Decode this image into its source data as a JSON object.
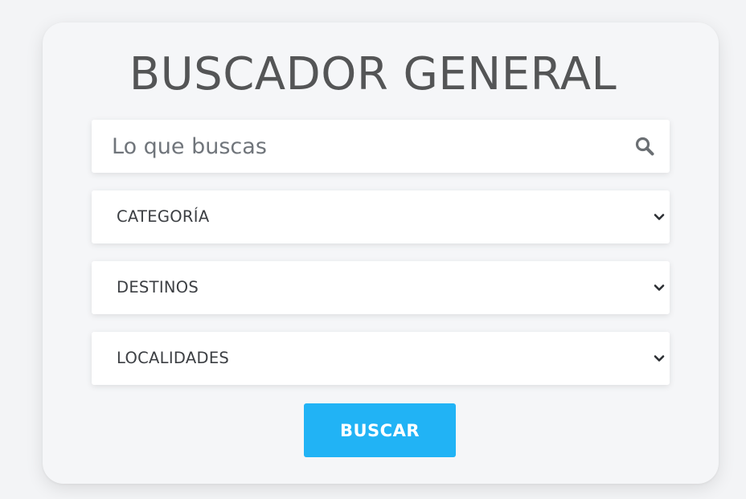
{
  "title": "BUSCADOR GENERAL",
  "search": {
    "placeholder": "Lo que buscas",
    "value": "",
    "icon": "search-icon"
  },
  "selects": {
    "category": {
      "selected": "CATEGORÍA",
      "icon": "chevron-down-icon"
    },
    "destinations": {
      "selected": "DESTINOS",
      "icon": "chevron-down-icon"
    },
    "localities": {
      "selected": "LOCALIDADES",
      "icon": "chevron-down-icon"
    }
  },
  "button": {
    "label": "BUSCAR"
  },
  "colors": {
    "accent": "#21b3f5",
    "title": "#545556",
    "card_background": "#f5f6f8",
    "page_background": "#f3f4f6"
  }
}
